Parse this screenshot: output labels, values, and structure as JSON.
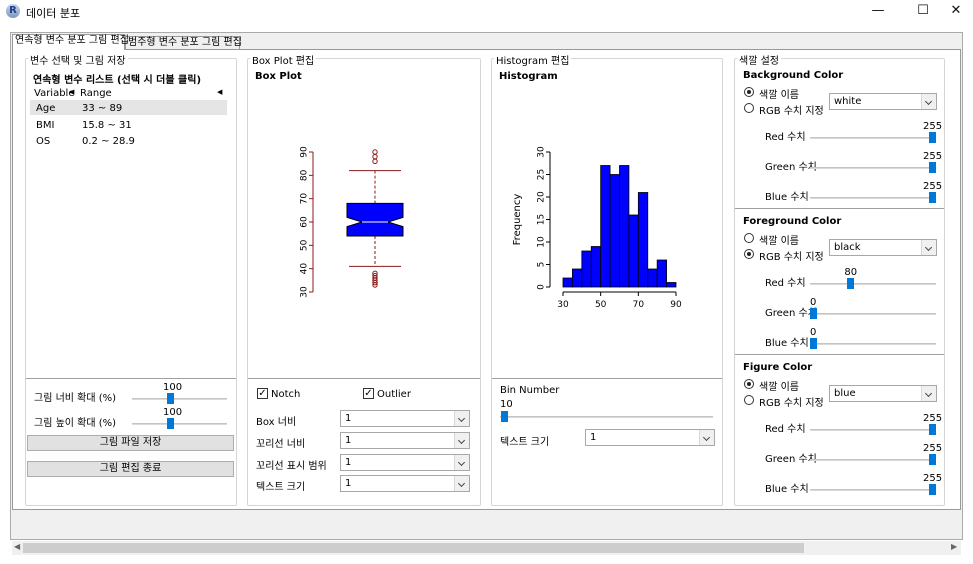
{
  "window": {
    "title": "데이터 분포",
    "minimize": "—",
    "maximize": "☐",
    "close": "✕",
    "icon_letter": "R"
  },
  "tabs": [
    {
      "label": "연속형 변수 분포 그림 편집",
      "active": true
    },
    {
      "label": "범주형 변수 분포 그림 편집",
      "active": false
    }
  ],
  "var_panel": {
    "caption": "변수 선택 및 그림 저장",
    "list_title": "연속형 변수 리스트 (선택 시 더블 클릭)",
    "col_variable": "Variable",
    "col_range": "Range",
    "rows": [
      {
        "variable": "Age",
        "range": "33 ~ 89"
      },
      {
        "variable": "BMI",
        "range": "15.8 ~ 31"
      },
      {
        "variable": "OS",
        "range": "0.2 ~ 28.9"
      }
    ],
    "width_label": "그림 너비 확대 (%)",
    "width_value": "100",
    "height_label": "그림 높이 확대 (%)",
    "height_value": "100",
    "save_button": "그림 파일 저장",
    "exit_button": "그림 편집 종료"
  },
  "boxplot_panel": {
    "caption": "Box Plot 편집",
    "plot_title": "Box Plot",
    "notch_label": "Notch",
    "notch_checked": true,
    "outlier_label": "Outlier",
    "outlier_checked": true,
    "box_width_label": "Box 너비",
    "box_width_value": "1",
    "whisker_width_label": "꼬리선 너비",
    "whisker_width_value": "1",
    "whisker_range_label": "꼬리선 표시 범위",
    "whisker_range_value": "1",
    "text_size_label": "텍스트 크기",
    "text_size_value": "1"
  },
  "histogram_panel": {
    "caption": "Histogram 편집",
    "plot_title": "Histogram",
    "bin_label": "Bin Number",
    "bin_value": "10",
    "bin_fraction": 0.0,
    "text_size_label": "텍스트 크기",
    "text_size_value": "1"
  },
  "color_panel": {
    "caption": "색깔 설정",
    "background": {
      "title": "Background Color",
      "opt_name": "색깔 이름",
      "opt_rgb": "RGB 수치 지정",
      "selected": "name",
      "color_name": "white",
      "red_label": "Red 수치",
      "red": 255,
      "green_label": "Green 수치",
      "green": 255,
      "blue_label": "Blue 수치",
      "blue": 255
    },
    "foreground": {
      "title": "Foreground Color",
      "opt_name": "색깔 이름",
      "opt_rgb": "RGB 수치 지정",
      "selected": "rgb",
      "color_name": "black",
      "red_label": "Red 수치",
      "red": 80,
      "green_label": "Green 수치",
      "green": 0,
      "blue_label": "Blue 수치",
      "blue": 0
    },
    "figure": {
      "title": "Figure Color",
      "opt_name": "색깔 이름",
      "opt_rgb": "RGB 수치 지정",
      "selected": "name",
      "color_name": "blue",
      "red_label": "Red 수치",
      "red": 255,
      "green_label": "Green 수치",
      "green": 255,
      "blue_label": "Blue 수치",
      "blue": 255
    }
  },
  "colors": {
    "accent": "#0078d7",
    "fill": "#0000ff",
    "plot_line": "#8b1a1a"
  },
  "chart_data": [
    {
      "type": "box",
      "title": "Box Plot",
      "ylim": [
        30,
        90
      ],
      "yticks": [
        30,
        40,
        50,
        60,
        70,
        80,
        90
      ],
      "whisker_low": 41,
      "q1": 54,
      "median": 60,
      "q3": 68,
      "whisker_high": 82,
      "notch_low": 58,
      "notch_high": 62,
      "outliers": [
        33,
        34,
        35,
        36,
        37,
        38,
        86,
        88,
        90
      ],
      "notch": true
    },
    {
      "type": "bar",
      "title": "Histogram",
      "ylabel": "Frequency",
      "bin_edges": [
        30,
        35,
        40,
        45,
        50,
        55,
        60,
        65,
        70,
        75,
        80,
        85,
        90
      ],
      "values": [
        2,
        4,
        8,
        9,
        27,
        25,
        27,
        16,
        21,
        4,
        6,
        1
      ],
      "ylim": [
        0,
        30
      ],
      "yticks": [
        0,
        5,
        10,
        15,
        20,
        25,
        30
      ],
      "xticks": [
        30,
        50,
        70,
        90
      ]
    }
  ]
}
